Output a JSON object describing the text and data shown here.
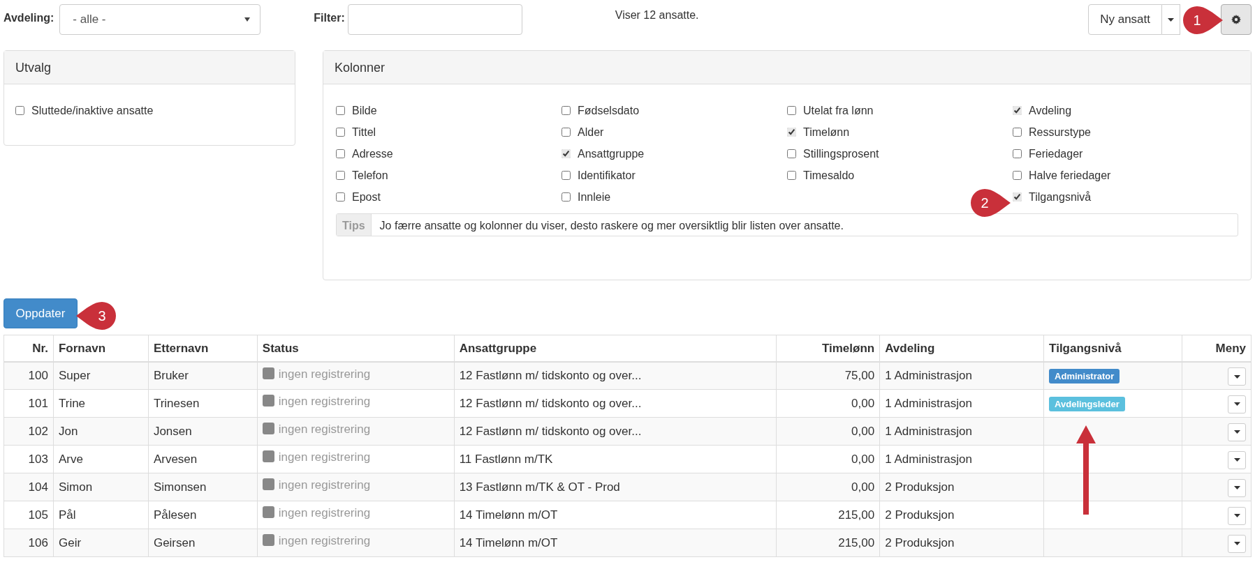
{
  "filters": {
    "department": {
      "label": "Avdeling:",
      "value": "- alle -"
    },
    "filter": {
      "label": "Filter:"
    }
  },
  "summary": "Viser 12 ansatte.",
  "toolbar": {
    "new_button": "Ny ansatt"
  },
  "selection_panel": {
    "title": "Utvalg",
    "options": [
      {
        "label": "Sluttede/inaktive ansatte",
        "checked": false
      }
    ]
  },
  "columns_panel": {
    "title": "Kolonner",
    "groups": [
      [
        {
          "label": "Bilde",
          "checked": false
        },
        {
          "label": "Tittel",
          "checked": false
        },
        {
          "label": "Adresse",
          "checked": false
        },
        {
          "label": "Telefon",
          "checked": false
        },
        {
          "label": "Epost",
          "checked": false
        }
      ],
      [
        {
          "label": "Fødselsdato",
          "checked": false
        },
        {
          "label": "Alder",
          "checked": false
        },
        {
          "label": "Ansattgruppe",
          "checked": true
        },
        {
          "label": "Identifikator",
          "checked": false
        },
        {
          "label": "Innleie",
          "checked": false
        }
      ],
      [
        {
          "label": "Utelat fra lønn",
          "checked": false
        },
        {
          "label": "Timelønn",
          "checked": true
        },
        {
          "label": "Stillingsprosent",
          "checked": false
        },
        {
          "label": "Timesaldo",
          "checked": false
        }
      ],
      [
        {
          "label": "Avdeling",
          "checked": true
        },
        {
          "label": "Ressurstype",
          "checked": false
        },
        {
          "label": "Feriedager",
          "checked": false
        },
        {
          "label": "Halve feriedager",
          "checked": false
        },
        {
          "label": "Tilgangsnivå",
          "checked": true
        }
      ]
    ],
    "tips": {
      "label": "Tips",
      "text": "Jo færre ansatte og kolonner du viser, desto raskere og mer oversiktlig blir listen over ansatte."
    }
  },
  "update_button": "Oppdater",
  "table": {
    "columns": [
      {
        "label": "Nr."
      },
      {
        "label": "Fornavn"
      },
      {
        "label": "Etternavn"
      },
      {
        "label": "Status"
      },
      {
        "label": "Ansattgruppe"
      },
      {
        "label": "Timelønn"
      },
      {
        "label": "Avdeling"
      },
      {
        "label": "Tilgangsnivå"
      },
      {
        "label": "Meny"
      }
    ],
    "rows": [
      {
        "nr": "100",
        "first_name": "Super",
        "last_name": "Bruker",
        "status": "ingen registrering",
        "group": "12 Fastlønn m/ tidskonto og over...",
        "wage": "75,00",
        "department": "1 Administrasjon",
        "access": {
          "label": "Administrator",
          "color": "#428bca"
        }
      },
      {
        "nr": "101",
        "first_name": "Trine",
        "last_name": "Trinesen",
        "status": "ingen registrering",
        "group": "12 Fastlønn m/ tidskonto og over...",
        "wage": "0,00",
        "department": "1 Administrasjon",
        "access": {
          "label": "Avdelingsleder",
          "color": "#5bc0de"
        }
      },
      {
        "nr": "102",
        "first_name": "Jon",
        "last_name": "Jonsen",
        "status": "ingen registrering",
        "group": "12 Fastlønn m/ tidskonto og over...",
        "wage": "0,00",
        "department": "1 Administrasjon"
      },
      {
        "nr": "103",
        "first_name": "Arve",
        "last_name": "Arvesen",
        "status": "ingen registrering",
        "group": "11 Fastlønn m/TK",
        "wage": "0,00",
        "department": "1 Administrasjon"
      },
      {
        "nr": "104",
        "first_name": "Simon",
        "last_name": "Simonsen",
        "status": "ingen registrering",
        "group": "13 Fastlønn m/TK & OT - Prod",
        "wage": "0,00",
        "department": "2 Produksjon"
      },
      {
        "nr": "105",
        "first_name": "Pål",
        "last_name": "Pålesen",
        "status": "ingen registrering",
        "group": "14 Timelønn m/OT",
        "wage": "215,00",
        "department": "2 Produksjon"
      },
      {
        "nr": "106",
        "first_name": "Geir",
        "last_name": "Geirsen",
        "status": "ingen registrering",
        "group": "14 Timelønn m/OT",
        "wage": "215,00",
        "department": "2 Produksjon"
      }
    ]
  },
  "callouts": [
    {
      "number": "1"
    },
    {
      "number": "2"
    },
    {
      "number": "3"
    }
  ]
}
